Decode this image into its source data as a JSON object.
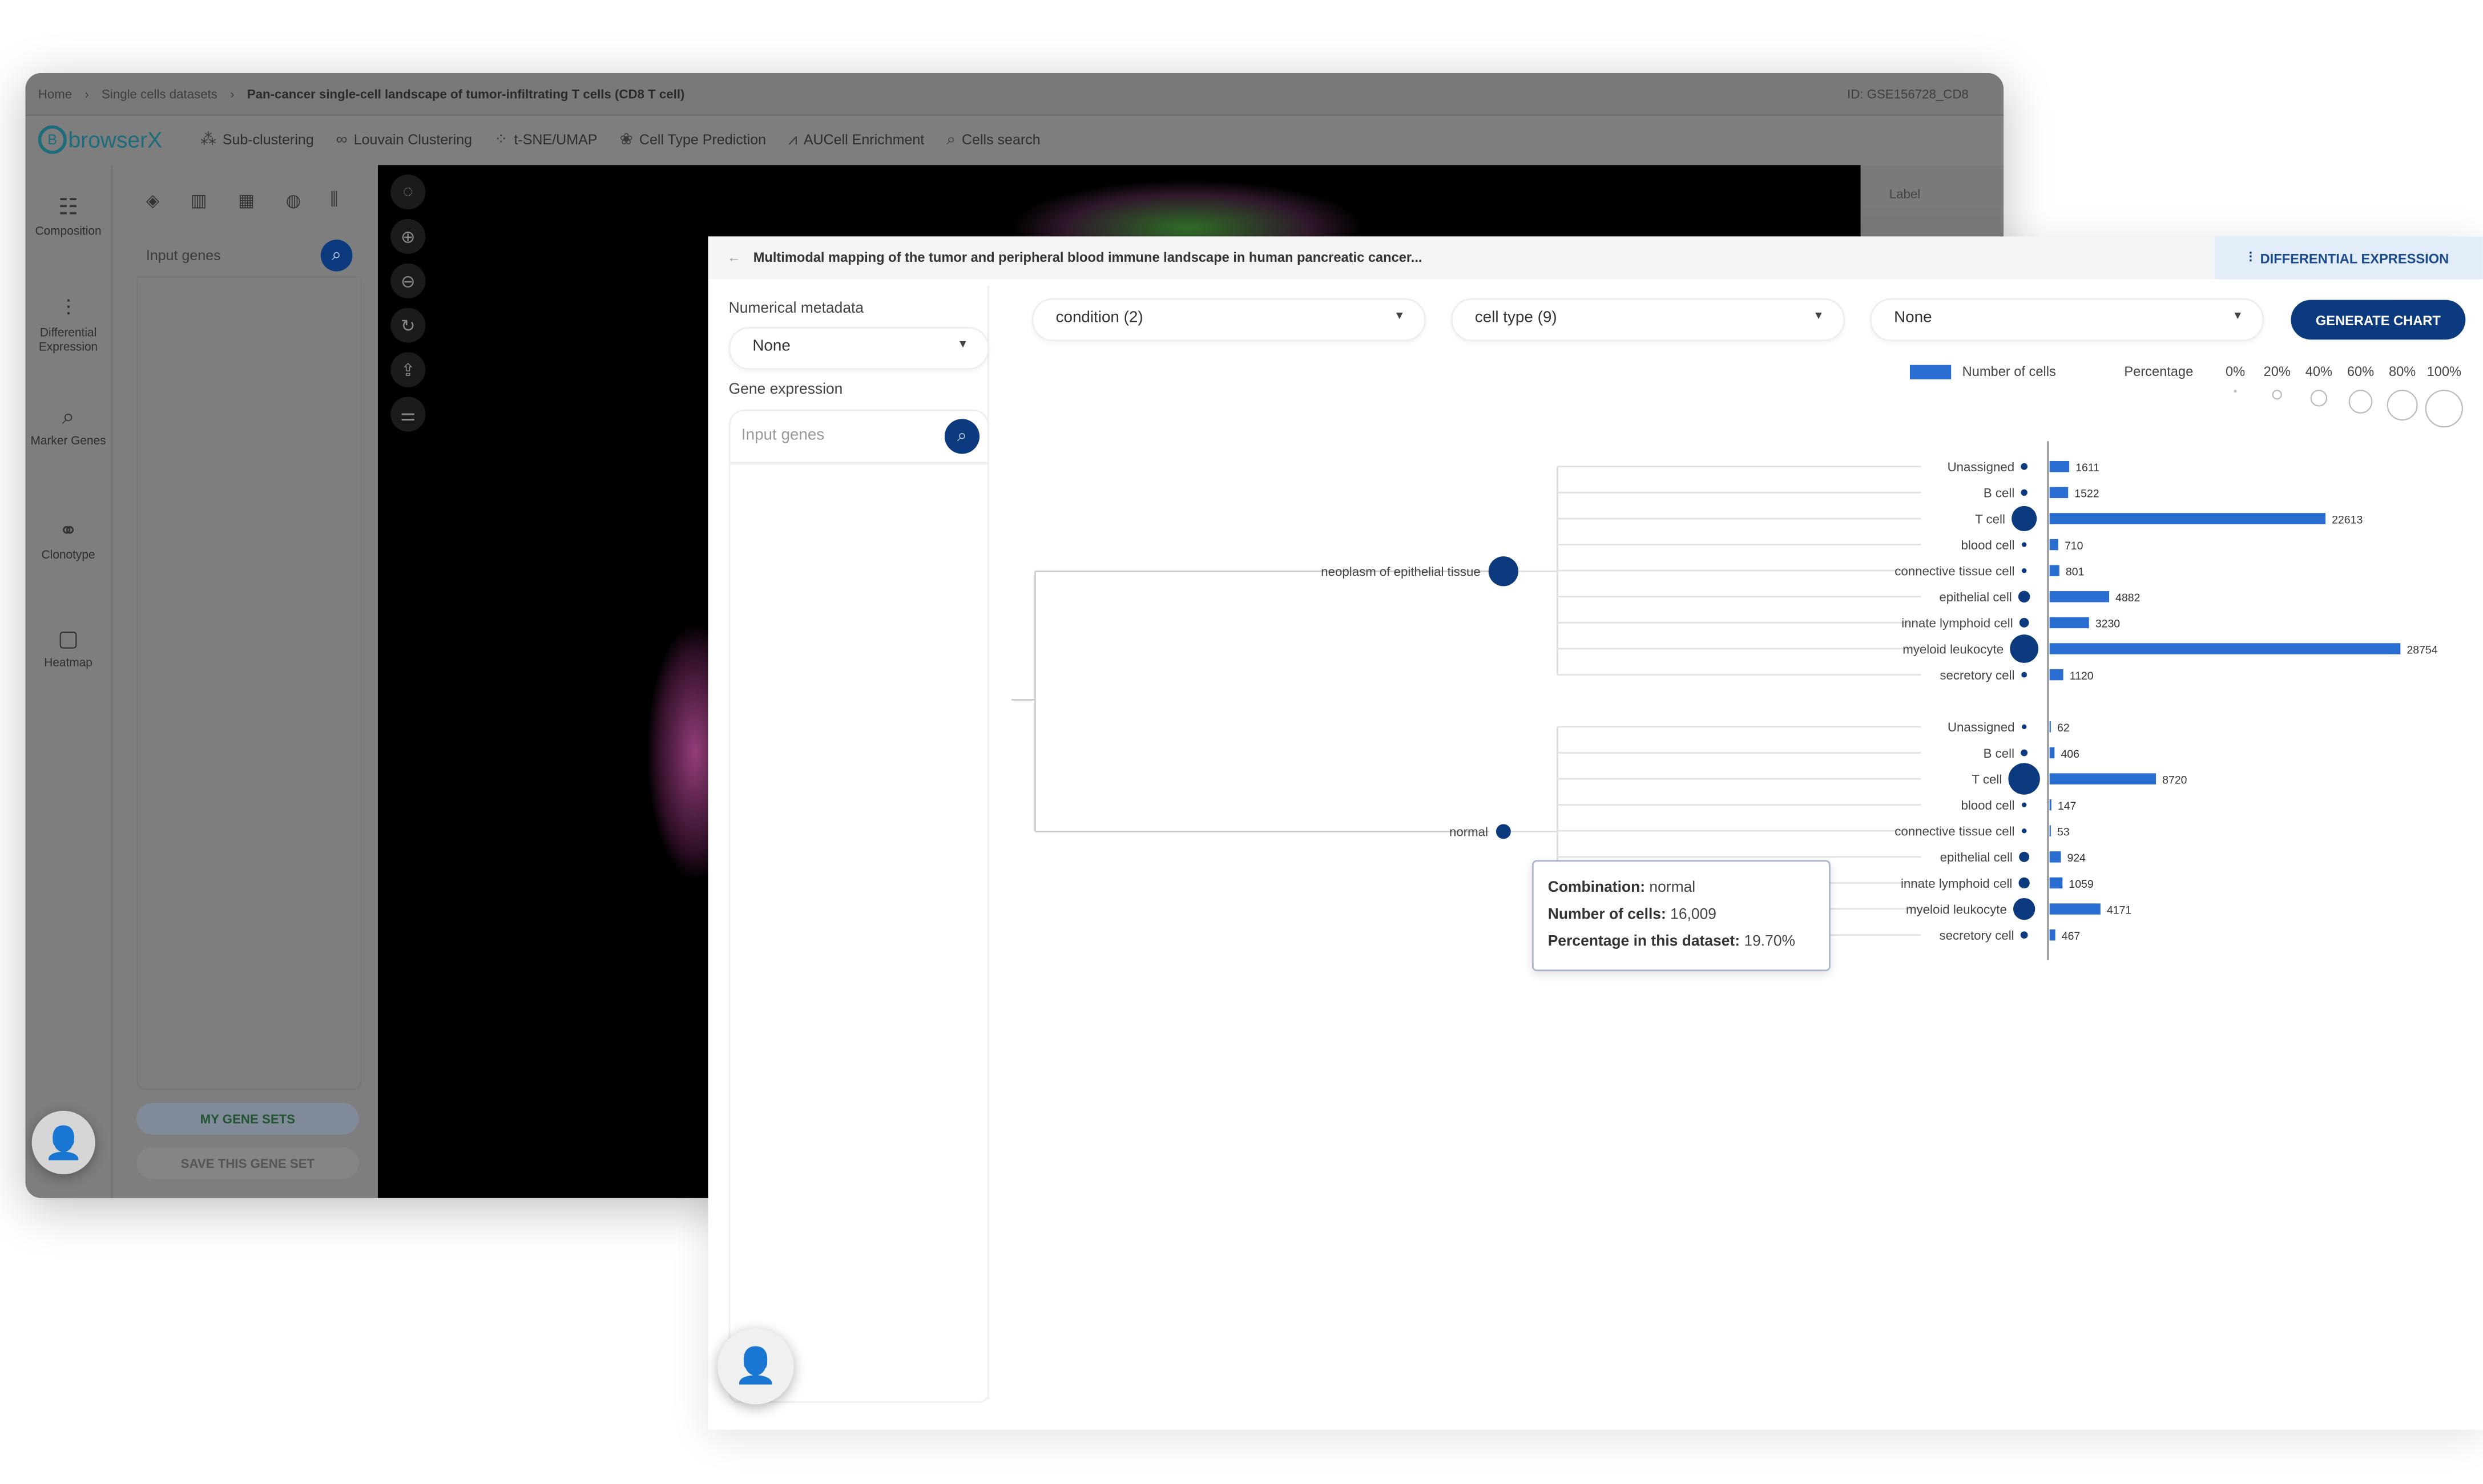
{
  "background_window": {
    "breadcrumb": [
      "Home",
      "Single cells datasets",
      "Pan-cancer single-cell landscape of tumor-infiltrating T cells (CD8 T cell)"
    ],
    "dataset_id": "ID: GSE156728_CD8",
    "logo": "browserX",
    "nav": [
      {
        "label": "Sub-clustering",
        "icon": "sub-clustering-icon"
      },
      {
        "label": "Louvain Clustering",
        "icon": "louvain-icon"
      },
      {
        "label": "t-SNE/UMAP",
        "icon": "scatter-icon"
      },
      {
        "label": "Cell Type Prediction",
        "icon": "prediction-icon"
      },
      {
        "label": "AUCell Enrichment",
        "icon": "enrichment-icon"
      },
      {
        "label": "Cells search",
        "icon": "search-icon"
      }
    ],
    "rail": [
      {
        "label": "Composition"
      },
      {
        "label": "Differential Expression"
      },
      {
        "label": "Marker Genes"
      },
      {
        "label": "Clonotype"
      },
      {
        "label": "Heatmap"
      }
    ],
    "gene_input_placeholder": "Input genes",
    "my_gene_sets": "MY GENE SETS",
    "save_gene_set": "SAVE THIS GENE SET",
    "right_panel_label": "Label"
  },
  "front_window": {
    "title": "Multimodal mapping of the tumor and peripheral blood immune landscape in human pancreatic cancer...",
    "tab": "DIFFERENTIAL EXPRESSION",
    "numerical_metadata_label": "Numerical metadata",
    "numerical_metadata_value": "None",
    "gene_expression_label": "Gene expression",
    "gene_input_placeholder": "Input genes",
    "selects": [
      "condition (2)",
      "cell type (9)",
      "None"
    ],
    "generate_button": "GENERATE CHART",
    "tooltip": {
      "combination_label": "Combination:",
      "combination_value": "normal",
      "cells_label": "Number of cells:",
      "cells_value": "16,009",
      "pct_label": "Percentage in this dataset:",
      "pct_value": "19.70%"
    }
  },
  "chart_data": {
    "type": "bar",
    "bar_color": "#2a6dd0",
    "node_color": "#0b3b7e",
    "legend": {
      "bar_label": "Number of cells",
      "size_label": "Percentage",
      "size_ticks": [
        "0%",
        "20%",
        "40%",
        "60%",
        "80%",
        "100%"
      ]
    },
    "groups": [
      {
        "name": "neoplasm of epithelial tissue",
        "categories": [
          "Unassigned",
          "B cell",
          "T cell",
          "blood cell",
          "connective tissue cell",
          "epithelial cell",
          "innate lymphoid cell",
          "myeloid leukocyte",
          "secretory cell"
        ],
        "values": [
          1611,
          1522,
          22613,
          710,
          801,
          4882,
          3230,
          28754,
          1120
        ]
      },
      {
        "name": "normal",
        "categories": [
          "Unassigned",
          "B cell",
          "T cell",
          "blood cell",
          "connective tissue cell",
          "epithelial cell",
          "innate lymphoid cell",
          "myeloid leukocyte",
          "secretory cell"
        ],
        "values": [
          62,
          406,
          8720,
          147,
          53,
          924,
          1059,
          4171,
          467
        ]
      }
    ]
  }
}
